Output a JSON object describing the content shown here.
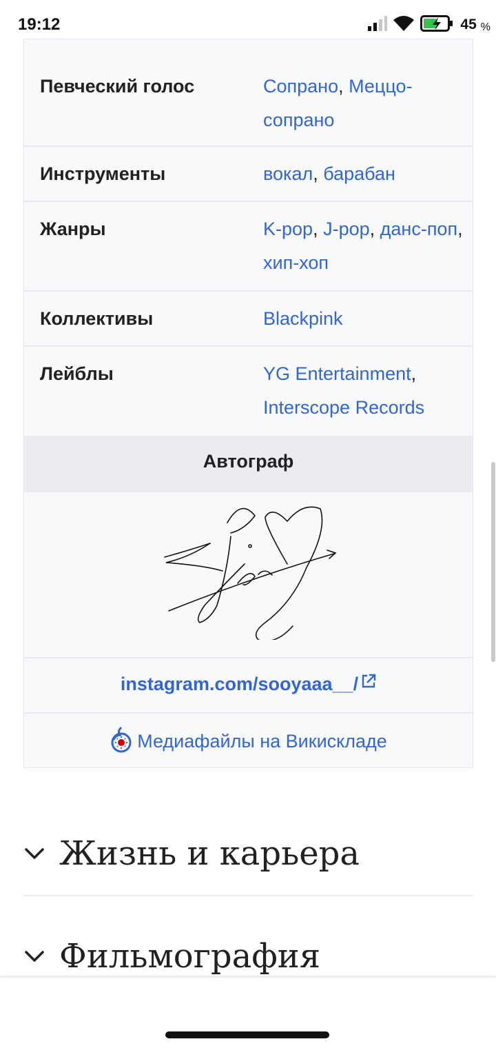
{
  "status_bar": {
    "time": "19:12",
    "battery_level": "45",
    "battery_unit": "%",
    "icons": [
      "signal-icon",
      "wifi-icon",
      "battery-charging-icon"
    ]
  },
  "infobox": {
    "rows": [
      {
        "label": "Певческий голос",
        "links": [
          "Сопрано",
          "Меццо-сопрано"
        ],
        "seps": [
          ", "
        ]
      },
      {
        "label": "Инструменты",
        "links": [
          "вокал",
          "барабан"
        ],
        "seps": [
          ", "
        ]
      },
      {
        "label": "Жанры",
        "links": [
          "K-pop",
          "J-pop",
          "данс-поп",
          "хип-хоп"
        ],
        "seps": [
          ", ",
          ", ",
          ", "
        ]
      },
      {
        "label": "Коллективы",
        "links": [
          "Blackpink"
        ],
        "seps": []
      },
      {
        "label": "Лейблы",
        "links": [
          "YG Entertainment",
          "Interscope Records"
        ],
        "seps": [
          ", "
        ]
      }
    ],
    "autograph_heading": "Автограф",
    "instagram_link": "instagram.com/sooyaaa__/",
    "commons_link": "Медиафайлы на Викискладе"
  },
  "sections": [
    {
      "title": "Жизнь и карьера"
    },
    {
      "title": "Фильмография"
    }
  ],
  "colors": {
    "link": "#3366cc",
    "text": "#202122",
    "infobox_bg": "#f8f9fa",
    "heading_bg": "#eaecf0"
  }
}
